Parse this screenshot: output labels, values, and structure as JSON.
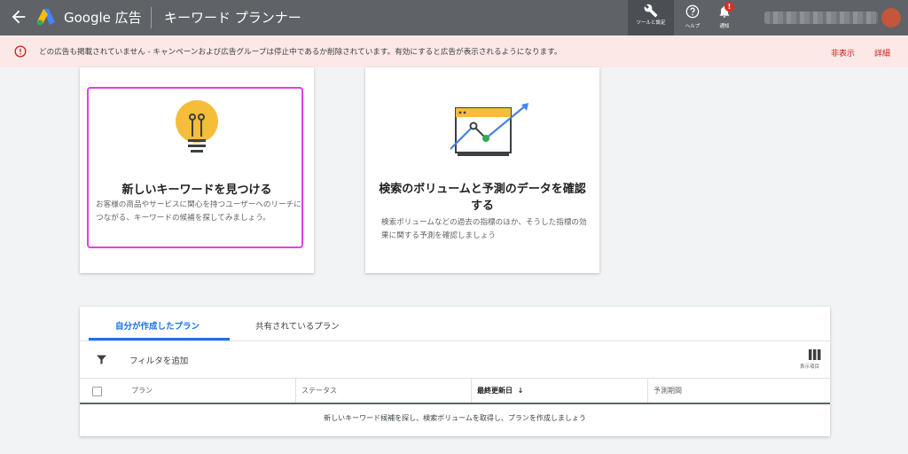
{
  "topbar": {
    "brand": "Google 広告",
    "product": "キーワード プランナー",
    "tools_label": "ツールと設定",
    "help_label": "ヘルプ",
    "notifications_label": "通知",
    "notifications_count": "!",
    "colors": {
      "bar": "#5f6368",
      "tools_active": "#4b4f53",
      "badge": "#d93025"
    }
  },
  "alert": {
    "message": "どの広告も掲載されていません - キャンペーンおよび広告グループは停止中であるか削除されています。有効にすると広告が表示されるようになります。",
    "hide": "非表示",
    "details": "詳細",
    "icon": "error-icon",
    "colors": {
      "background": "#fce8e6",
      "accent": "#c5221f"
    }
  },
  "cards": [
    {
      "title": "新しいキーワードを見つける",
      "description": "お客様の商品やサービスに関心を持つユーザーへのリーチにつながる、キーワードの候補を探してみましょう。",
      "icon": "lightbulb-icon"
    },
    {
      "title": "検索のボリュームと予測のデータを確認する",
      "description": "検索ボリュームなどの過去の指標のほか、そうした指標の効果に関する予測を確認しましょう",
      "icon": "trend-chart-icon"
    }
  ],
  "plans": {
    "tabs": [
      {
        "label": "自分が作成したプラン",
        "active": true
      },
      {
        "label": "共有されているプラン",
        "active": false
      }
    ],
    "filter_label": "フィルタを追加",
    "columns_label": "表示項目",
    "columns": [
      "プラン",
      "ステータス",
      "最終更新日",
      "予測期間"
    ],
    "sort_indicator": "↓",
    "empty_message": "新しいキーワード候補を探し、検索ボリュームを取得し、プランを作成しましょう",
    "colors": {
      "accent": "#1a73e8"
    }
  }
}
